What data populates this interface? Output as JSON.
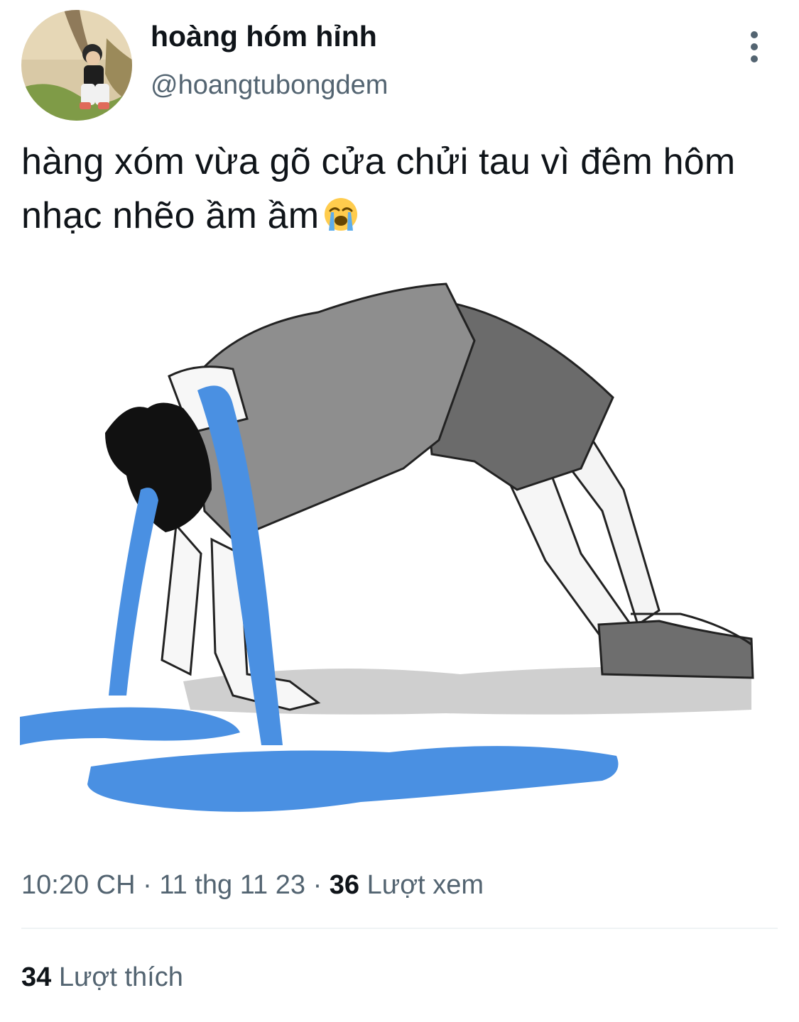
{
  "tweet": {
    "author": {
      "display_name": "hoàng hóm hỉnh",
      "handle": "@hoangtubongdem",
      "avatar_icon": "profile-photo"
    },
    "more_icon": "more-vertical-icon",
    "text": "hàng xóm vừa gõ cửa chửi tau vì đêm hôm nhạc nhẽo ầm ầm",
    "emoji": "😭",
    "media": {
      "icon": "crying-cartoon-meme-image",
      "tear_color": "#4a90e2"
    },
    "meta": {
      "time": "10:20 CH",
      "separator": "·",
      "date": "11 thg 11 23",
      "views_count": "36",
      "views_label": "Lượt xem"
    },
    "likes": {
      "count": "34",
      "label": "Lượt thích"
    }
  }
}
